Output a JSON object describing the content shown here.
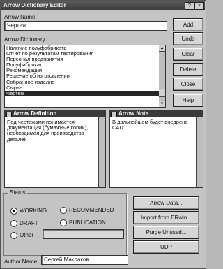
{
  "window": {
    "title": "Arrow Dictionary Editor"
  },
  "titlebar_buttons": [
    "?",
    "×"
  ],
  "arrow_name": {
    "label": "Arrow Name",
    "value": "Чертеж"
  },
  "dictionary": {
    "label": "Arrow Dictionary",
    "items": [
      "Наличие полуфабриката",
      "Отчет по результатам тестирования",
      "Персонал предприятия",
      "Полуфабрикат",
      "Рекомендации",
      "Решение об изготовлении",
      "Собранное изделие",
      "Сырье",
      "Чертеж"
    ],
    "selected_index": 8
  },
  "right_buttons": {
    "add": "Add",
    "undo": "Undo",
    "clear": "Clear",
    "delete": "Delete",
    "close": "Close",
    "help": "Help"
  },
  "definition": {
    "title": "Arrow Definition",
    "text": "Под чертежами понимается документация (бумажные копии), необходимая для производства деталей"
  },
  "note": {
    "title": "Arrow Note",
    "text": "В дальнейшем будет внедрена CAD."
  },
  "status": {
    "label": "Status",
    "options": {
      "working": "WORKING",
      "recommended": "RECOMMENDED",
      "draft": "DRAFT",
      "publication": "PUBLICATION",
      "other": "Other"
    },
    "selected": "WORKING",
    "other_value": ""
  },
  "action_buttons": {
    "arrow_data": "Arrow Data...",
    "import": "Import from ERwin...",
    "purge": "Purge Unused...",
    "udp": "UDP"
  },
  "author": {
    "label": "Author Name:",
    "value": "Сергей Маклаков"
  }
}
